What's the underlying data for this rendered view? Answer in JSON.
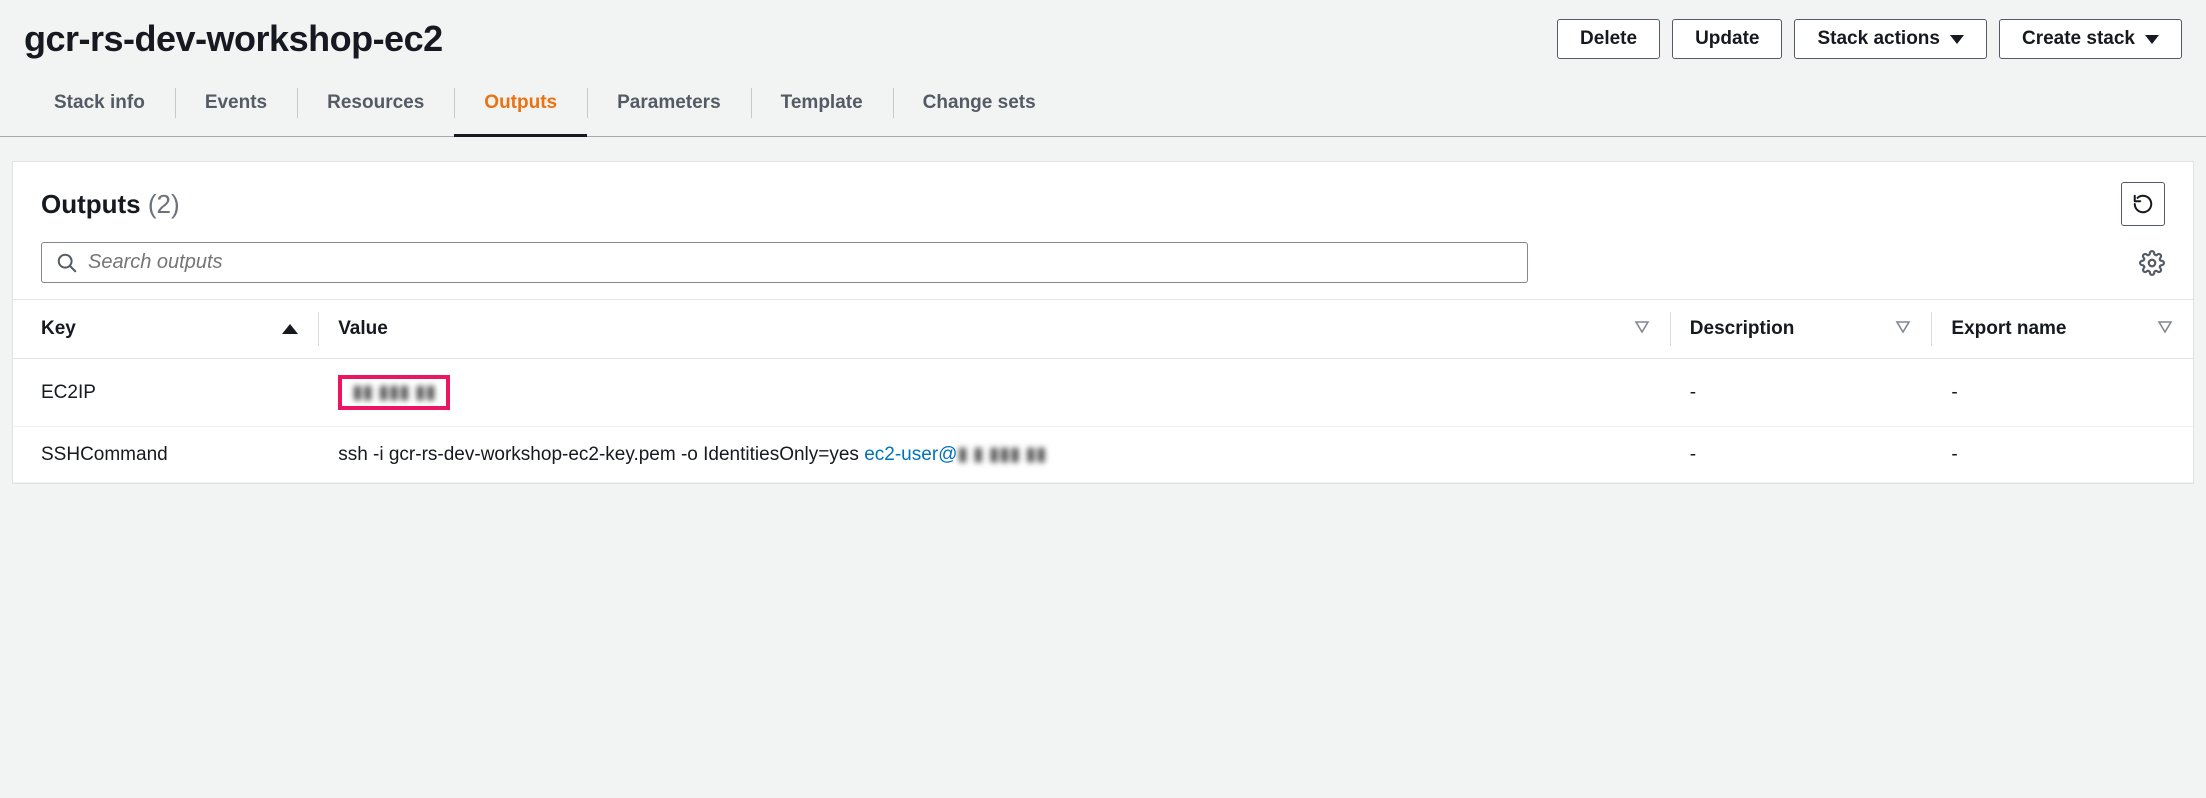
{
  "header": {
    "title": "gcr-rs-dev-workshop-ec2",
    "buttons": {
      "delete": "Delete",
      "update": "Update",
      "stack_actions": "Stack actions",
      "create_stack": "Create stack"
    }
  },
  "tabs": [
    {
      "id": "stackinfo",
      "label": "Stack info",
      "active": false
    },
    {
      "id": "events",
      "label": "Events",
      "active": false
    },
    {
      "id": "resources",
      "label": "Resources",
      "active": false
    },
    {
      "id": "outputs",
      "label": "Outputs",
      "active": true
    },
    {
      "id": "parameters",
      "label": "Parameters",
      "active": false
    },
    {
      "id": "template",
      "label": "Template",
      "active": false
    },
    {
      "id": "changesets",
      "label": "Change sets",
      "active": false
    }
  ],
  "panel": {
    "title": "Outputs",
    "count": "(2)",
    "search_placeholder": "Search outputs",
    "columns": {
      "key": "Key",
      "value": "Value",
      "description": "Description",
      "export_name": "Export name"
    },
    "rows": [
      {
        "key": "EC2IP",
        "value_prefix": "",
        "value_redacted": "▮▮ ▮▮▮ ▮▮",
        "value_link_prefix": "",
        "description": "-",
        "export_name": "-",
        "highlight": true
      },
      {
        "key": "SSHCommand",
        "value_prefix": "ssh -i gcr-rs-dev-workshop-ec2-key.pem -o IdentitiesOnly=yes ",
        "value_link_prefix": "ec2-user@",
        "value_redacted": "▮ ▮ ▮▮▮ ▮▮",
        "description": "-",
        "export_name": "-",
        "highlight": false
      }
    ]
  }
}
